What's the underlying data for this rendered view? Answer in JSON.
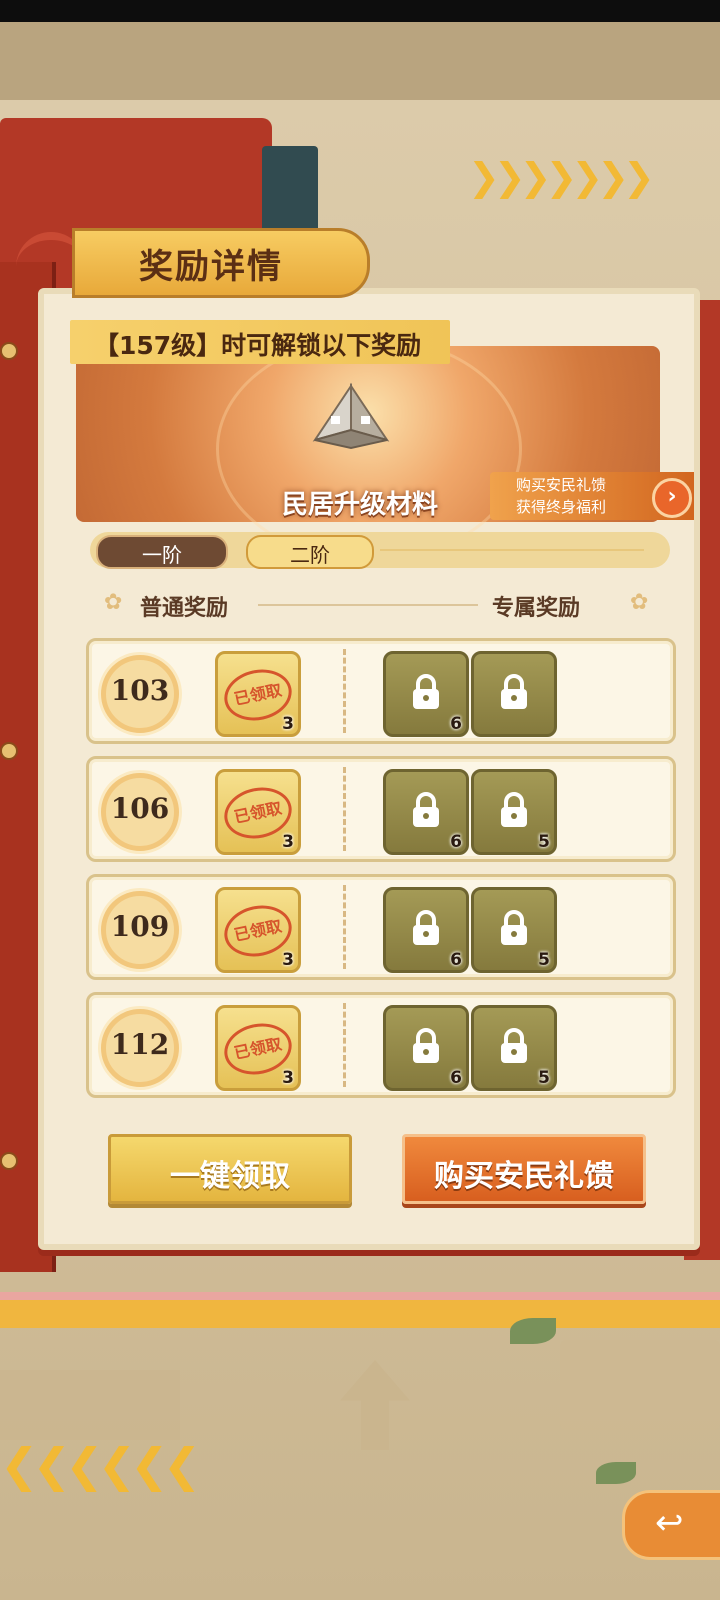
{
  "title": "奖励详情",
  "unlock_banner": "【157级】时可解锁以下奖励",
  "hero": {
    "item_label": "民居升级材料",
    "buy_tag_line1": "购买安民礼馈",
    "buy_tag_line2": "获得终身福利",
    "arrow_icon": "chevron-right-icon"
  },
  "tabs": [
    {
      "label": "一阶",
      "selected": false
    },
    {
      "label": "二阶",
      "selected": true
    }
  ],
  "sections": {
    "normal": "普通奖励",
    "exclusive": "专属奖励"
  },
  "rows": [
    {
      "level": "103",
      "normal": {
        "status": "已领取",
        "count": "3"
      },
      "exclusive": [
        {
          "icon": "tent-icon",
          "count": "6",
          "locked": true
        },
        {
          "icon": "wreath-avatar-frame-icon",
          "count": "",
          "locked": true
        }
      ]
    },
    {
      "level": "106",
      "normal": {
        "status": "已领取",
        "count": "3"
      },
      "exclusive": [
        {
          "icon": "tent-icon",
          "count": "6",
          "locked": true
        },
        {
          "icon": "stone-icon",
          "count": "5",
          "locked": true
        }
      ]
    },
    {
      "level": "109",
      "normal": {
        "status": "已领取",
        "count": "3"
      },
      "exclusive": [
        {
          "icon": "tent-icon",
          "count": "6",
          "locked": true
        },
        {
          "icon": "stone-icon",
          "count": "5",
          "locked": true
        }
      ]
    },
    {
      "level": "112",
      "normal": {
        "status": "已领取",
        "count": "3"
      },
      "exclusive": [
        {
          "icon": "tent-icon",
          "count": "6",
          "locked": true
        },
        {
          "icon": "stone-icon",
          "count": "5",
          "locked": true
        }
      ]
    }
  ],
  "buttons": {
    "claim_all": "一键领取",
    "buy": "购买安民礼馈"
  },
  "colors": {
    "accent_orange": "#d85f1f",
    "gold": "#f0c457",
    "locked": "#857a3d"
  }
}
